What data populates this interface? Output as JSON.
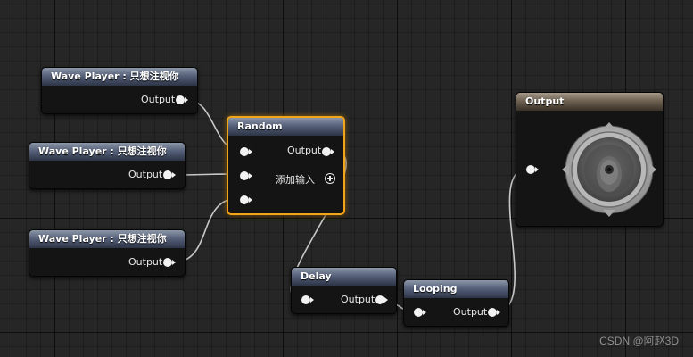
{
  "nodes": {
    "wave_player_1": {
      "title": "Wave Player : 只想注视你",
      "output_label": "Output"
    },
    "wave_player_2": {
      "title": "Wave Player : 只想注视你",
      "output_label": "Output"
    },
    "wave_player_3": {
      "title": "Wave Player : 只想注视你",
      "output_label": "Output"
    },
    "random": {
      "title": "Random",
      "output_label": "Output",
      "add_input_label": "添加输入",
      "selected": true
    },
    "delay": {
      "title": "Delay",
      "output_label": "Output"
    },
    "looping": {
      "title": "Looping",
      "output_label": "Output"
    },
    "output": {
      "title": "Output",
      "icon": "speaker-icon"
    }
  },
  "colors": {
    "selection_outline": "#f2a51a",
    "wire": "#c8c8c8",
    "pin": "#f2f2f2",
    "graph_background": "#262626"
  },
  "watermark": "CSDN @阿赵3D"
}
